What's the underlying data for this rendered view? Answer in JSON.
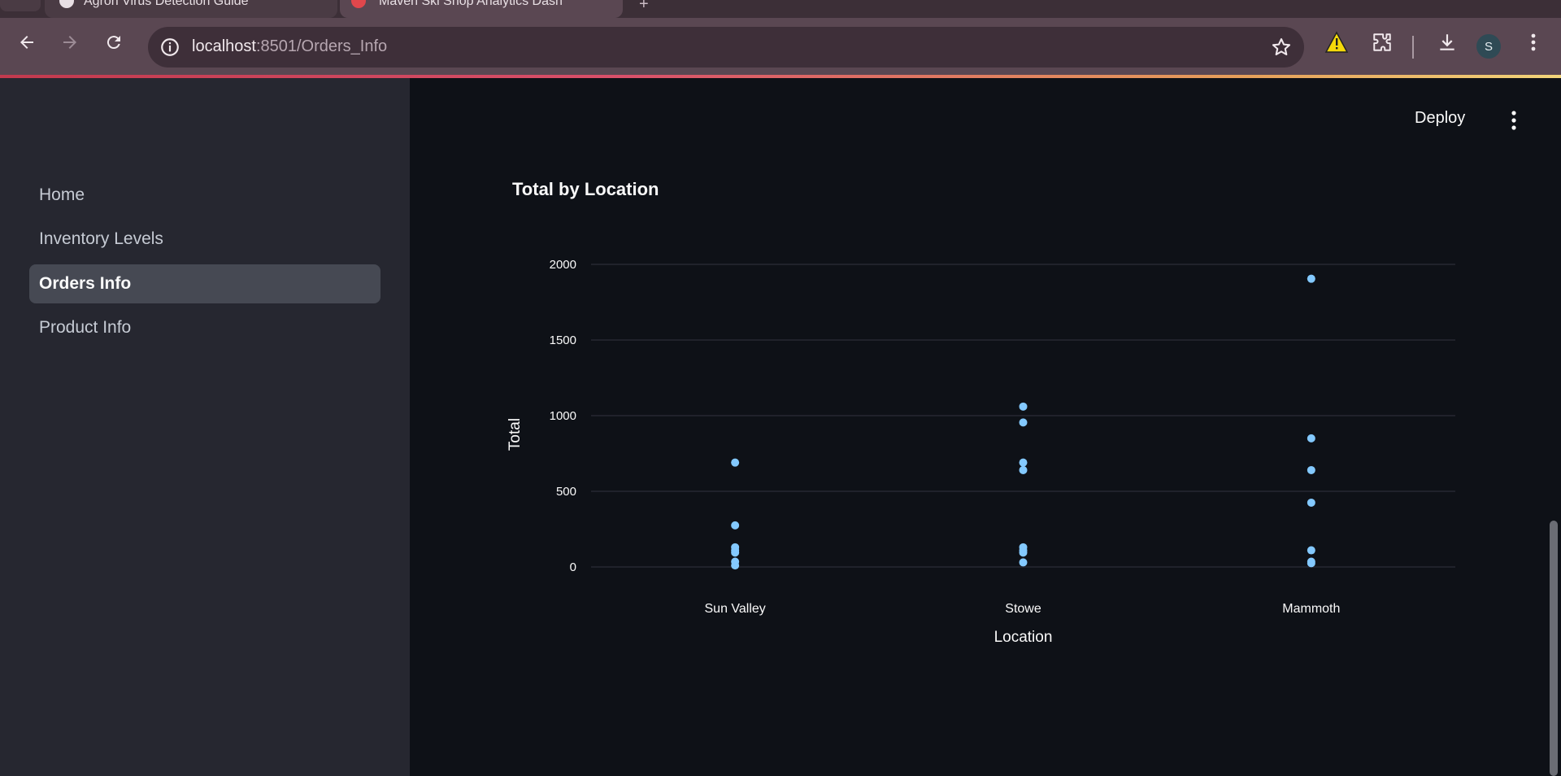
{
  "browser": {
    "tabs": [
      {
        "title": "Agron Virus Detection Guide"
      },
      {
        "title": "Maven Ski Shop Analytics Dash"
      }
    ],
    "url_host": "localhost",
    "url_path": ":8501/Orders_Info",
    "avatar_letter": "S"
  },
  "sidebar": {
    "items": [
      {
        "label": "Home",
        "active": false
      },
      {
        "label": "Inventory Levels",
        "active": false
      },
      {
        "label": "Orders Info",
        "active": true
      },
      {
        "label": "Product Info",
        "active": false
      }
    ]
  },
  "header": {
    "deploy_label": "Deploy"
  },
  "chart_data": {
    "type": "scatter",
    "title": "Total by Location",
    "xlabel": "Location",
    "ylabel": "Total",
    "categories": [
      "Sun Valley",
      "Stowe",
      "Mammoth"
    ],
    "ylim": [
      0,
      2000
    ],
    "yticks": [
      0,
      500,
      1000,
      1500,
      2000
    ],
    "grid": true,
    "point_color": "#83c9ff",
    "points": [
      {
        "x": "Sun Valley",
        "y": 690
      },
      {
        "x": "Sun Valley",
        "y": 275
      },
      {
        "x": "Sun Valley",
        "y": 130
      },
      {
        "x": "Sun Valley",
        "y": 110
      },
      {
        "x": "Sun Valley",
        "y": 95
      },
      {
        "x": "Sun Valley",
        "y": 35
      },
      {
        "x": "Sun Valley",
        "y": 10
      },
      {
        "x": "Stowe",
        "y": 1060
      },
      {
        "x": "Stowe",
        "y": 955
      },
      {
        "x": "Stowe",
        "y": 690
      },
      {
        "x": "Stowe",
        "y": 640
      },
      {
        "x": "Stowe",
        "y": 130
      },
      {
        "x": "Stowe",
        "y": 110
      },
      {
        "x": "Stowe",
        "y": 95
      },
      {
        "x": "Stowe",
        "y": 30
      },
      {
        "x": "Mammoth",
        "y": 1905
      },
      {
        "x": "Mammoth",
        "y": 850
      },
      {
        "x": "Mammoth",
        "y": 640
      },
      {
        "x": "Mammoth",
        "y": 425
      },
      {
        "x": "Mammoth",
        "y": 110
      },
      {
        "x": "Mammoth",
        "y": 35
      },
      {
        "x": "Mammoth",
        "y": 25
      }
    ]
  }
}
